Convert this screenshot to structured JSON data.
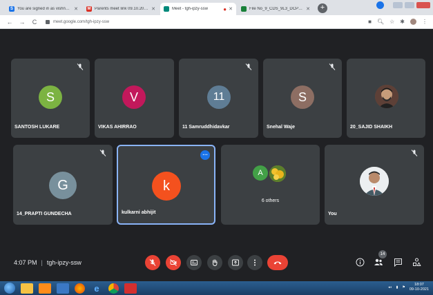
{
  "browser": {
    "tabs": [
      {
        "label": "You are signed in as vishnu005",
        "favicon_color": "#1a73e8",
        "favicon_text": "S",
        "active": false
      },
      {
        "label": "Parents meet link 09.10.2021 - 8",
        "favicon_color": "#d93025",
        "favicon_text": "M",
        "active": false
      },
      {
        "label": "Meet - tgh-ipzy-ssw",
        "favicon_color": "#00897b",
        "favicon_text": "",
        "active": true
      },
      {
        "label": "",
        "favicon_color": "#d93025",
        "favicon_text": "",
        "active": false
      },
      {
        "label": "File No_9_CDS_9L3_DCP_MoM_",
        "favicon_color": "#188038",
        "favicon_text": "",
        "active": false
      }
    ],
    "url": "meet.google.com/tgh-ipzy-ssw"
  },
  "meeting": {
    "time": "4:07 PM",
    "code": "tgh-ipzy-ssw",
    "participant_count": "14"
  },
  "tiles": [
    {
      "name": "SANTOSH LUKARE",
      "initial": "S",
      "color": "#7cb342",
      "muted": true
    },
    {
      "name": "VIKAS AHIRRAO",
      "initial": "V",
      "color": "#c2185b",
      "muted": false
    },
    {
      "name": "11 Samruddhidavkar",
      "initial": "11",
      "color": "#5f7d95",
      "muted": true
    },
    {
      "name": "Snehal Waje",
      "initial": "S",
      "color": "#8d6e63",
      "muted": true
    },
    {
      "name": "20_SAJID SHAIKH",
      "initial": "",
      "color": "",
      "muted": false
    },
    {
      "name": "14_PRAPTI GUNDECHA",
      "initial": "G",
      "color": "#78909c",
      "muted": true
    },
    {
      "name": "kulkarni abhijit",
      "initial": "k",
      "color": "#f4511e",
      "muted": false
    },
    {
      "name": "6 others",
      "initial": "A",
      "color": "#43a047",
      "muted": false
    },
    {
      "name": "You",
      "initial": "",
      "color": "",
      "muted": true
    }
  ],
  "taskbar": {
    "time": "18:07",
    "date": "09-10-2021"
  }
}
